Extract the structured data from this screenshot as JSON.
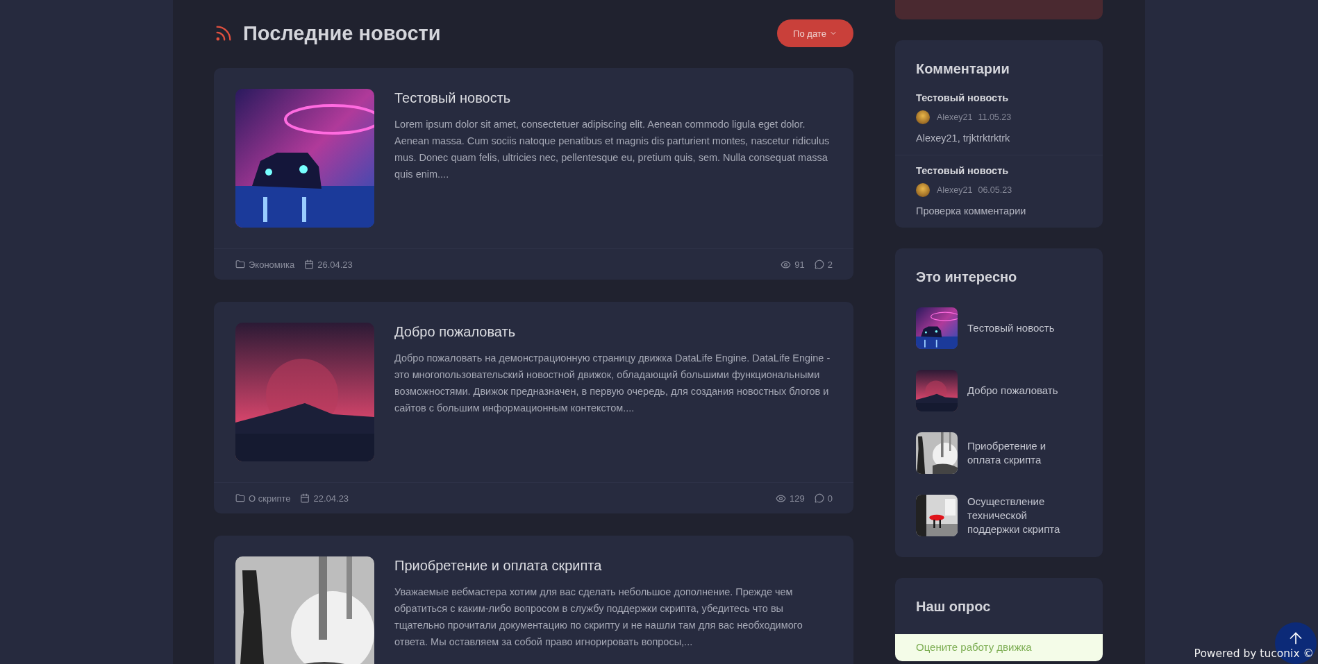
{
  "section": {
    "title": "Последние новости",
    "sort_button": "По дате"
  },
  "articles": [
    {
      "title": "Тестовый новость",
      "excerpt": "Lorem ipsum dolor sit amet, consectetuer adipiscing elit. Aenean commodo ligula eget dolor. Aenean massa. Cum sociis natoque penatibus et magnis dis parturient montes, nascetur ridiculus mus. Donec quam felis, ultricies nec, pellentesque eu, pretium quis, sem. Nulla consequat massa quis enim....",
      "category": "Экономика",
      "date": "26.04.23",
      "views": "91",
      "comments": "2"
    },
    {
      "title": "Добро пожаловать",
      "excerpt": "Добро пожаловать на демонстрационную страницу движка DataLife Engine. DataLife Engine - это многопользовательский новостной движок, обладающий большими функциональными возможностями. Движок предназначен, в первую очередь, для создания новостных блогов и сайтов с большим информационным контекстом....",
      "category": "О скрипте",
      "date": "22.04.23",
      "views": "129",
      "comments": "0"
    },
    {
      "title": "Приобретение и оплата скрипта",
      "excerpt": "Уважаемые вебмастера хотим для вас сделать небольшое дополнение. Прежде чем обратиться с каким-либо вопросом в службу поддержки скрипта, убедитесь что вы тщательно прочитали документацию по скрипту и не нашли там для вас необходимого ответа. Мы оставляем за собой право игнорировать вопросы,..."
    }
  ],
  "sidebar": {
    "comments": {
      "title": "Комментарии",
      "items": [
        {
          "article": "Тестовый новость",
          "author": "Alexey21",
          "date": "11.05.23",
          "text": "Alexey21, trjktrktrktrk"
        },
        {
          "article": "Тестовый новость",
          "author": "Alexey21",
          "date": "06.05.23",
          "text": "Проверка комментарии"
        }
      ]
    },
    "interesting": {
      "title": "Это интересно",
      "items": [
        {
          "title": "Тестовый новость"
        },
        {
          "title": "Добро пожаловать"
        },
        {
          "title": "Приобретение и оплата скрипта"
        },
        {
          "title": "Осуществление технической поддержки скрипта"
        }
      ]
    },
    "poll": {
      "title": "Наш опрос",
      "question": "Оцените работу движка"
    }
  },
  "footer_badge": "Powered by tuconix ©"
}
